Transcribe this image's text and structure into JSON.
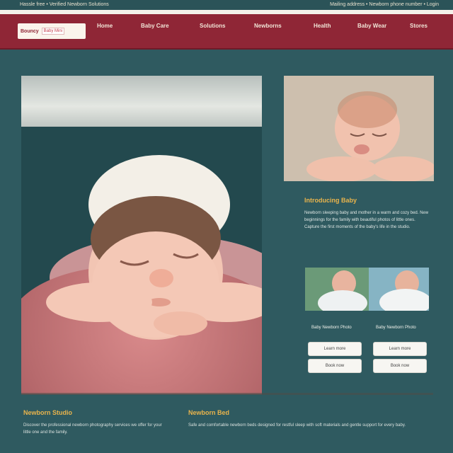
{
  "topbar": {
    "left_text": "Hassle free  •  Verified Newborn Solutions",
    "right_text": "Mailing address  •  Newborn phone number  •  Login"
  },
  "logo": {
    "name": "Bouncy",
    "badge": "Baby Mini"
  },
  "nav": {
    "items": [
      "Home",
      "Baby Care",
      "Solutions",
      "Newborns",
      "Health",
      "Baby Wear",
      "Stores"
    ]
  },
  "about": {
    "title": "Introducing Baby",
    "text": "Newborn sleeping baby and mother in a warm and cozy bed. New beginnings for the family with beautiful photos of little ones. Capture the first moments of the baby's life in the studio."
  },
  "thumbs": {
    "left_caption": "Baby Newborn Photo",
    "right_caption": "Baby Newborn Photo",
    "buttons": [
      "Learn more",
      "Learn more",
      "Book now",
      "Book now"
    ]
  },
  "footer": {
    "col1_title": "Newborn Studio",
    "col1_text": "Discover the professional newborn photography services we offer for your little one and the family.",
    "col2_title": "Newborn Bed",
    "col2_text": "Safe and comfortable newborn beds designed for restful sleep with soft materials and gentle support for every baby."
  },
  "colors": {
    "background": "#2f5a60",
    "nav": "#8f2636",
    "accent": "#e9b44c"
  }
}
